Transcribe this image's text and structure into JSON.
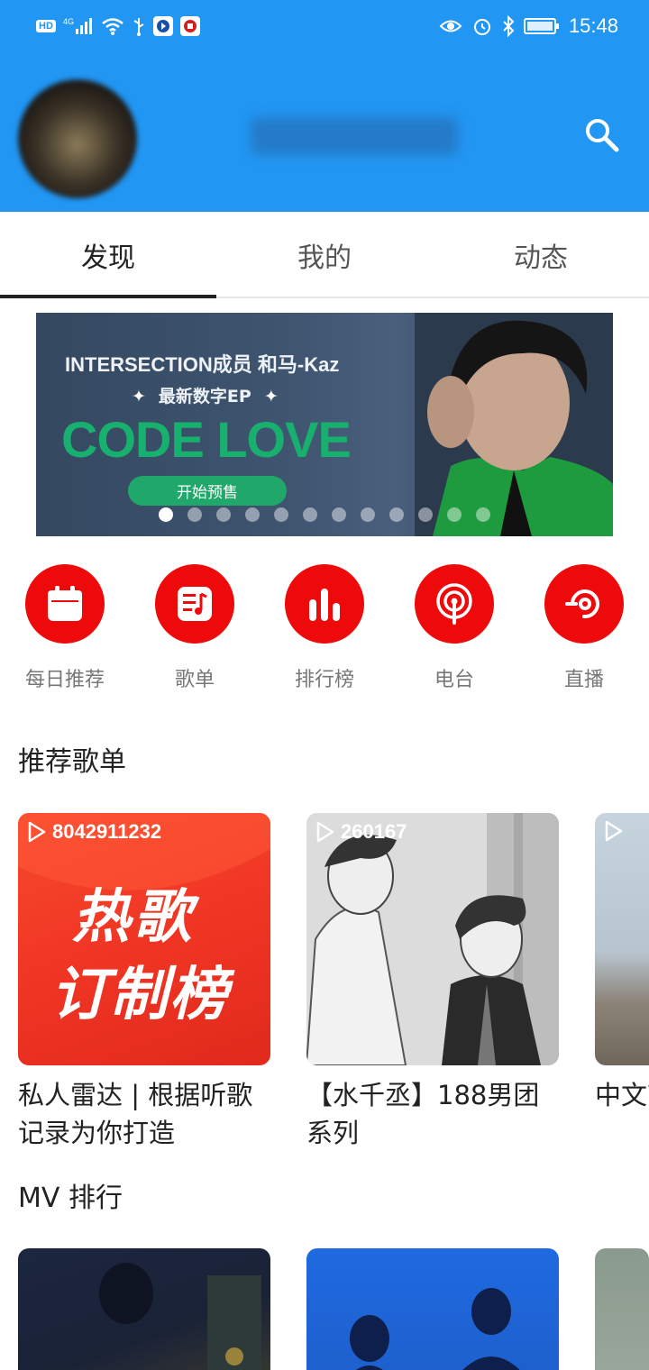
{
  "status_bar": {
    "left_badge": "HD",
    "network": "4G",
    "time": "15:48"
  },
  "header": {
    "username": "用户昵称",
    "search_icon": "search-icon"
  },
  "tabs": [
    {
      "label": "发现",
      "active": true
    },
    {
      "label": "我的",
      "active": false
    },
    {
      "label": "动态",
      "active": false
    }
  ],
  "banner": {
    "line1": "INTERSECTION成员 和马-Kaz",
    "line2": "最新数字EP",
    "star": "✦",
    "title": "CODE LOVE",
    "button": "开始预售",
    "dot_count": 12,
    "active_dot": 1
  },
  "quick_entries": [
    {
      "label": "每日推荐",
      "icon": "calendar-icon"
    },
    {
      "label": "歌单",
      "icon": "playlist-icon"
    },
    {
      "label": "排行榜",
      "icon": "chart-bars-icon"
    },
    {
      "label": "电台",
      "icon": "radio-icon"
    },
    {
      "label": "直播",
      "icon": "live-icon"
    }
  ],
  "sections": {
    "playlists_title": "推荐歌单",
    "mv_title": "MV 排行"
  },
  "playlists": [
    {
      "count": "8042911232",
      "title": "私人雷达 | 根据听歌记录为你打造",
      "cover_text_1": "热歌",
      "cover_text_2": "订制榜"
    },
    {
      "count": "260167",
      "title": "【水千丞】188男团系列"
    },
    {
      "count": "",
      "title": "中文节奏"
    }
  ],
  "colors": {
    "header": "#2196f3",
    "accent_red": "#ee0a0a",
    "banner_green": "#18b06e"
  }
}
